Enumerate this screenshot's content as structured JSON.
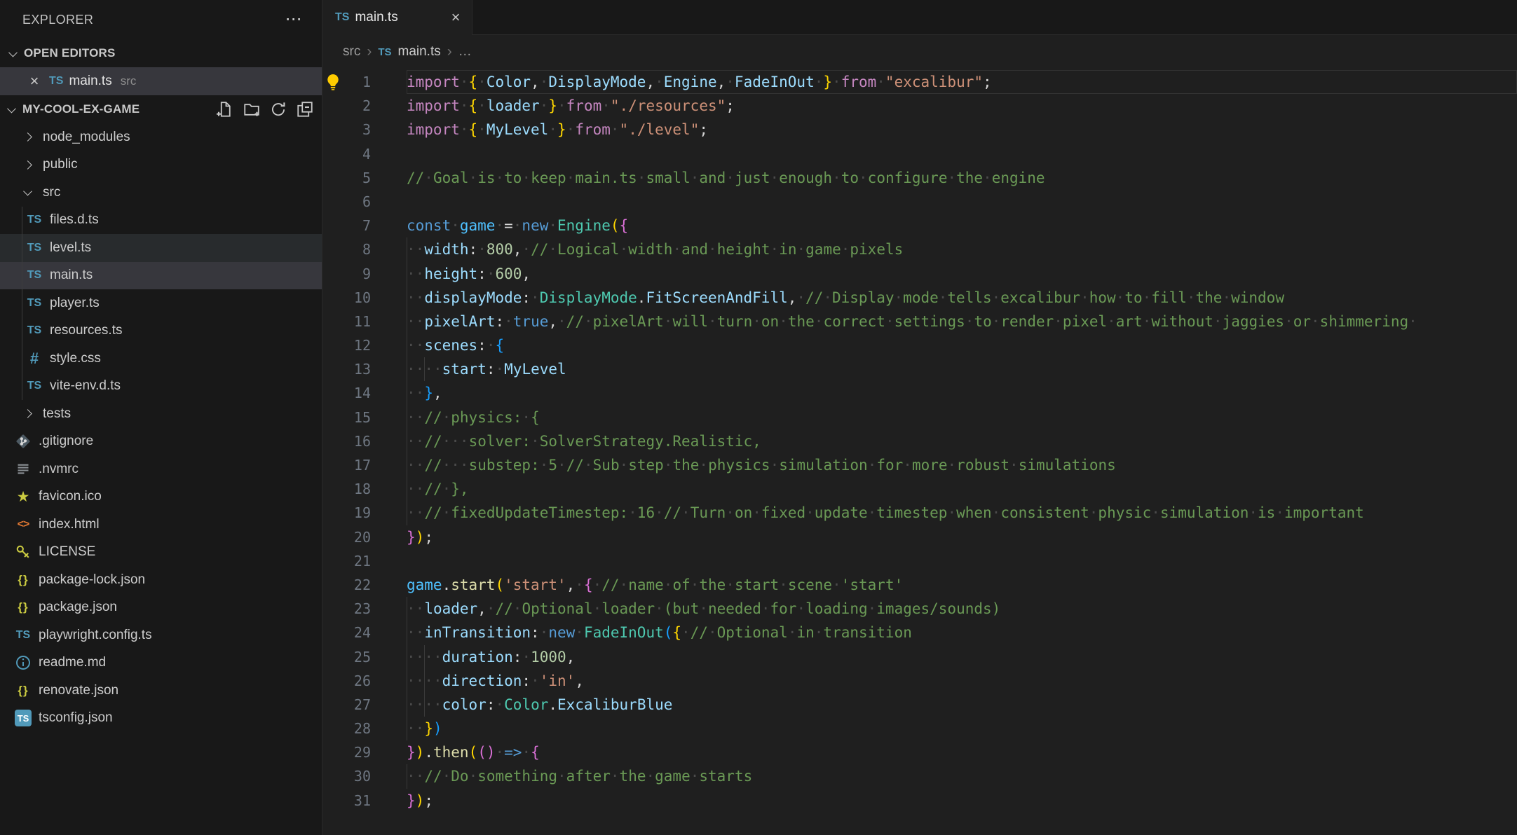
{
  "sidebar": {
    "title": "EXPLORER",
    "more_label": "⋯",
    "open_editors_label": "OPEN EDITORS",
    "workspace_label": "MY-COOL-EX-GAME",
    "open_editors": [
      {
        "name": "main.ts",
        "detail": "src",
        "icon": "ts",
        "close_label": "×"
      }
    ],
    "header_actions": [
      "new-file",
      "new-folder",
      "refresh",
      "collapse-all"
    ],
    "tree": [
      {
        "label": "node_modules",
        "kind": "folder",
        "icon": "chev-r",
        "level": 0
      },
      {
        "label": "public",
        "kind": "folder",
        "icon": "chev-r",
        "level": 0
      },
      {
        "label": "src",
        "kind": "folder",
        "icon": "chev-d",
        "level": 0
      },
      {
        "label": "files.d.ts",
        "kind": "file",
        "icon": "ts",
        "level": 1
      },
      {
        "label": "level.ts",
        "kind": "file",
        "icon": "ts",
        "level": 1,
        "state": "hover"
      },
      {
        "label": "main.ts",
        "kind": "file",
        "icon": "ts",
        "level": 1,
        "state": "selected"
      },
      {
        "label": "player.ts",
        "kind": "file",
        "icon": "ts",
        "level": 1
      },
      {
        "label": "resources.ts",
        "kind": "file",
        "icon": "ts",
        "level": 1
      },
      {
        "label": "style.css",
        "kind": "file",
        "icon": "css",
        "level": 1
      },
      {
        "label": "vite-env.d.ts",
        "kind": "file",
        "icon": "ts",
        "level": 1
      },
      {
        "label": "tests",
        "kind": "folder",
        "icon": "chev-r",
        "level": 0
      },
      {
        "label": ".gitignore",
        "kind": "file",
        "icon": "git",
        "level": 0
      },
      {
        "label": ".nvmrc",
        "kind": "file",
        "icon": "lines",
        "level": 0
      },
      {
        "label": "favicon.ico",
        "kind": "file",
        "icon": "star",
        "level": 0
      },
      {
        "label": "index.html",
        "kind": "file",
        "icon": "html",
        "level": 0
      },
      {
        "label": "LICENSE",
        "kind": "file",
        "icon": "key",
        "level": 0
      },
      {
        "label": "package-lock.json",
        "kind": "file",
        "icon": "json",
        "level": 0
      },
      {
        "label": "package.json",
        "kind": "file",
        "icon": "json",
        "level": 0
      },
      {
        "label": "playwright.config.ts",
        "kind": "file",
        "icon": "ts",
        "level": 0
      },
      {
        "label": "readme.md",
        "kind": "file",
        "icon": "info",
        "level": 0
      },
      {
        "label": "renovate.json",
        "kind": "file",
        "icon": "json",
        "level": 0
      },
      {
        "label": "tsconfig.json",
        "kind": "file",
        "icon": "tsconfig",
        "level": 0
      }
    ]
  },
  "tabs": [
    {
      "label": "main.ts",
      "icon": "ts",
      "close_label": "×",
      "active": true
    }
  ],
  "breadcrumb": {
    "items": [
      "src",
      "main.ts",
      "…"
    ],
    "separator": "›"
  },
  "theme": {
    "sidebar_bg": "#181818",
    "editor_bg": "#1f1f1f",
    "selected_row": "#37373d",
    "icon_blue": "#519aba",
    "icon_yellow": "#cbcb41",
    "icon_orange": "#e37933",
    "lightbulb": "#ffcc00",
    "comment": "#6A9955",
    "keyword": "#C586C0",
    "keyword_blue": "#569CD6",
    "variable": "#9CDCFE",
    "const_variable": "#4FC1FF",
    "class": "#4EC9B0",
    "function": "#DCDCAA",
    "string": "#CE9178",
    "number": "#B5CEA8",
    "bracket1": "#FFD700",
    "bracket2": "#DA70D6",
    "bracket3": "#179FFF",
    "line_number": "#6e7681"
  },
  "editor": {
    "lines": [
      {
        "n": 1,
        "current": true,
        "g": [],
        "tokens": [
          [
            "kw",
            "import "
          ],
          [
            "b1",
            "{ "
          ],
          [
            "var",
            "Color"
          ],
          [
            "pun",
            ", "
          ],
          [
            "var",
            "DisplayMode"
          ],
          [
            "pun",
            ", "
          ],
          [
            "var",
            "Engine"
          ],
          [
            "pun",
            ", "
          ],
          [
            "var",
            "FadeInOut "
          ],
          [
            "b1",
            "} "
          ],
          [
            "kw",
            "from "
          ],
          [
            "str",
            "\"excalibur\""
          ],
          [
            "pun",
            ";"
          ]
        ]
      },
      {
        "n": 2,
        "g": [],
        "tokens": [
          [
            "kw",
            "import "
          ],
          [
            "b1",
            "{ "
          ],
          [
            "var",
            "loader "
          ],
          [
            "b1",
            "} "
          ],
          [
            "kw",
            "from "
          ],
          [
            "str",
            "\"./resources\""
          ],
          [
            "pun",
            ";"
          ]
        ]
      },
      {
        "n": 3,
        "g": [],
        "tokens": [
          [
            "kw",
            "import "
          ],
          [
            "b1",
            "{ "
          ],
          [
            "var",
            "MyLevel "
          ],
          [
            "b1",
            "} "
          ],
          [
            "kw",
            "from "
          ],
          [
            "str",
            "\"./level\""
          ],
          [
            "pun",
            ";"
          ]
        ]
      },
      {
        "n": 4,
        "g": [],
        "tokens": []
      },
      {
        "n": 5,
        "g": [],
        "tokens": [
          [
            "com",
            "// Goal is to keep main.ts small and just enough to configure the engine"
          ]
        ]
      },
      {
        "n": 6,
        "g": [],
        "tokens": []
      },
      {
        "n": 7,
        "g": [],
        "tokens": [
          [
            "kb",
            "const "
          ],
          [
            "cvar",
            "game "
          ],
          [
            "pun",
            "= "
          ],
          [
            "kb",
            "new "
          ],
          [
            "cls",
            "Engine"
          ],
          [
            "b1",
            "("
          ],
          [
            "b2",
            "{"
          ]
        ]
      },
      {
        "n": 8,
        "g": [
          0
        ],
        "tokens": [
          [
            "pun",
            "  "
          ],
          [
            "var",
            "width"
          ],
          [
            "pun",
            ": "
          ],
          [
            "num",
            "800"
          ],
          [
            "pun",
            ", "
          ],
          [
            "com",
            "// Logical width and height in game pixels"
          ]
        ]
      },
      {
        "n": 9,
        "g": [
          0
        ],
        "tokens": [
          [
            "pun",
            "  "
          ],
          [
            "var",
            "height"
          ],
          [
            "pun",
            ": "
          ],
          [
            "num",
            "600"
          ],
          [
            "pun",
            ","
          ]
        ]
      },
      {
        "n": 10,
        "g": [
          0
        ],
        "tokens": [
          [
            "pun",
            "  "
          ],
          [
            "var",
            "displayMode"
          ],
          [
            "pun",
            ": "
          ],
          [
            "cls",
            "DisplayMode"
          ],
          [
            "pun",
            "."
          ],
          [
            "var",
            "FitScreenAndFill"
          ],
          [
            "pun",
            ", "
          ],
          [
            "com",
            "// Display mode tells excalibur how to fill the window"
          ]
        ]
      },
      {
        "n": 11,
        "g": [
          0
        ],
        "tokens": [
          [
            "pun",
            "  "
          ],
          [
            "var",
            "pixelArt"
          ],
          [
            "pun",
            ": "
          ],
          [
            "kb",
            "true"
          ],
          [
            "pun",
            ", "
          ],
          [
            "com",
            "// pixelArt will turn on the correct settings to render pixel art without jaggies or shimmering "
          ]
        ]
      },
      {
        "n": 12,
        "g": [
          0
        ],
        "tokens": [
          [
            "pun",
            "  "
          ],
          [
            "var",
            "scenes"
          ],
          [
            "pun",
            ": "
          ],
          [
            "b3",
            "{"
          ]
        ]
      },
      {
        "n": 13,
        "g": [
          0,
          2
        ],
        "tokens": [
          [
            "pun",
            "    "
          ],
          [
            "var",
            "start"
          ],
          [
            "pun",
            ": "
          ],
          [
            "var",
            "MyLevel"
          ]
        ]
      },
      {
        "n": 14,
        "g": [
          0
        ],
        "tokens": [
          [
            "pun",
            "  "
          ],
          [
            "b3",
            "}"
          ],
          [
            "pun",
            ","
          ]
        ]
      },
      {
        "n": 15,
        "g": [
          0
        ],
        "tokens": [
          [
            "pun",
            "  "
          ],
          [
            "com",
            "// physics: {"
          ]
        ]
      },
      {
        "n": 16,
        "g": [
          0
        ],
        "tokens": [
          [
            "pun",
            "  "
          ],
          [
            "com",
            "//   solver: SolverStrategy.Realistic,"
          ]
        ]
      },
      {
        "n": 17,
        "g": [
          0
        ],
        "tokens": [
          [
            "pun",
            "  "
          ],
          [
            "com",
            "//   substep: 5 // Sub step the physics simulation for more robust simulations"
          ]
        ]
      },
      {
        "n": 18,
        "g": [
          0
        ],
        "tokens": [
          [
            "pun",
            "  "
          ],
          [
            "com",
            "// },"
          ]
        ]
      },
      {
        "n": 19,
        "g": [
          0
        ],
        "tokens": [
          [
            "pun",
            "  "
          ],
          [
            "com",
            "// fixedUpdateTimestep: 16 // Turn on fixed update timestep when consistent physic simulation is important"
          ]
        ]
      },
      {
        "n": 20,
        "g": [],
        "tokens": [
          [
            "b2",
            "}"
          ],
          [
            "b1",
            ")"
          ],
          [
            "pun",
            ";"
          ]
        ]
      },
      {
        "n": 21,
        "g": [],
        "tokens": []
      },
      {
        "n": 22,
        "g": [],
        "tokens": [
          [
            "cvar",
            "game"
          ],
          [
            "pun",
            "."
          ],
          [
            "fn",
            "start"
          ],
          [
            "b1",
            "("
          ],
          [
            "str",
            "'start'"
          ],
          [
            "pun",
            ", "
          ],
          [
            "b2",
            "{ "
          ],
          [
            "com",
            "// name of the start scene 'start'"
          ]
        ]
      },
      {
        "n": 23,
        "g": [
          0
        ],
        "tokens": [
          [
            "pun",
            "  "
          ],
          [
            "var",
            "loader"
          ],
          [
            "pun",
            ", "
          ],
          [
            "com",
            "// Optional loader (but needed for loading images/sounds)"
          ]
        ]
      },
      {
        "n": 24,
        "g": [
          0
        ],
        "tokens": [
          [
            "pun",
            "  "
          ],
          [
            "var",
            "inTransition"
          ],
          [
            "pun",
            ": "
          ],
          [
            "kb",
            "new "
          ],
          [
            "cls",
            "FadeInOut"
          ],
          [
            "b3",
            "("
          ],
          [
            "b1",
            "{ "
          ],
          [
            "com",
            "// Optional in transition"
          ]
        ]
      },
      {
        "n": 25,
        "g": [
          0,
          2
        ],
        "tokens": [
          [
            "pun",
            "    "
          ],
          [
            "var",
            "duration"
          ],
          [
            "pun",
            ": "
          ],
          [
            "num",
            "1000"
          ],
          [
            "pun",
            ","
          ]
        ]
      },
      {
        "n": 26,
        "g": [
          0,
          2
        ],
        "tokens": [
          [
            "pun",
            "    "
          ],
          [
            "var",
            "direction"
          ],
          [
            "pun",
            ": "
          ],
          [
            "str",
            "'in'"
          ],
          [
            "pun",
            ","
          ]
        ]
      },
      {
        "n": 27,
        "g": [
          0,
          2
        ],
        "tokens": [
          [
            "pun",
            "    "
          ],
          [
            "var",
            "color"
          ],
          [
            "pun",
            ": "
          ],
          [
            "cls",
            "Color"
          ],
          [
            "pun",
            "."
          ],
          [
            "var",
            "ExcaliburBlue"
          ]
        ]
      },
      {
        "n": 28,
        "g": [
          0
        ],
        "tokens": [
          [
            "pun",
            "  "
          ],
          [
            "b1",
            "}"
          ],
          [
            "b3",
            ")"
          ]
        ]
      },
      {
        "n": 29,
        "g": [],
        "tokens": [
          [
            "b2",
            "}"
          ],
          [
            "b1",
            ")"
          ],
          [
            "pun",
            "."
          ],
          [
            "fn",
            "then"
          ],
          [
            "b1",
            "("
          ],
          [
            "b2",
            "()"
          ],
          [
            "pun",
            " "
          ],
          [
            "kb",
            "=> "
          ],
          [
            "b2",
            "{"
          ]
        ]
      },
      {
        "n": 30,
        "g": [
          0
        ],
        "tokens": [
          [
            "pun",
            "  "
          ],
          [
            "com",
            "// Do something after the game starts"
          ]
        ]
      },
      {
        "n": 31,
        "g": [],
        "tokens": [
          [
            "b2",
            "}"
          ],
          [
            "b1",
            ")"
          ],
          [
            "pun",
            ";"
          ]
        ]
      }
    ]
  }
}
